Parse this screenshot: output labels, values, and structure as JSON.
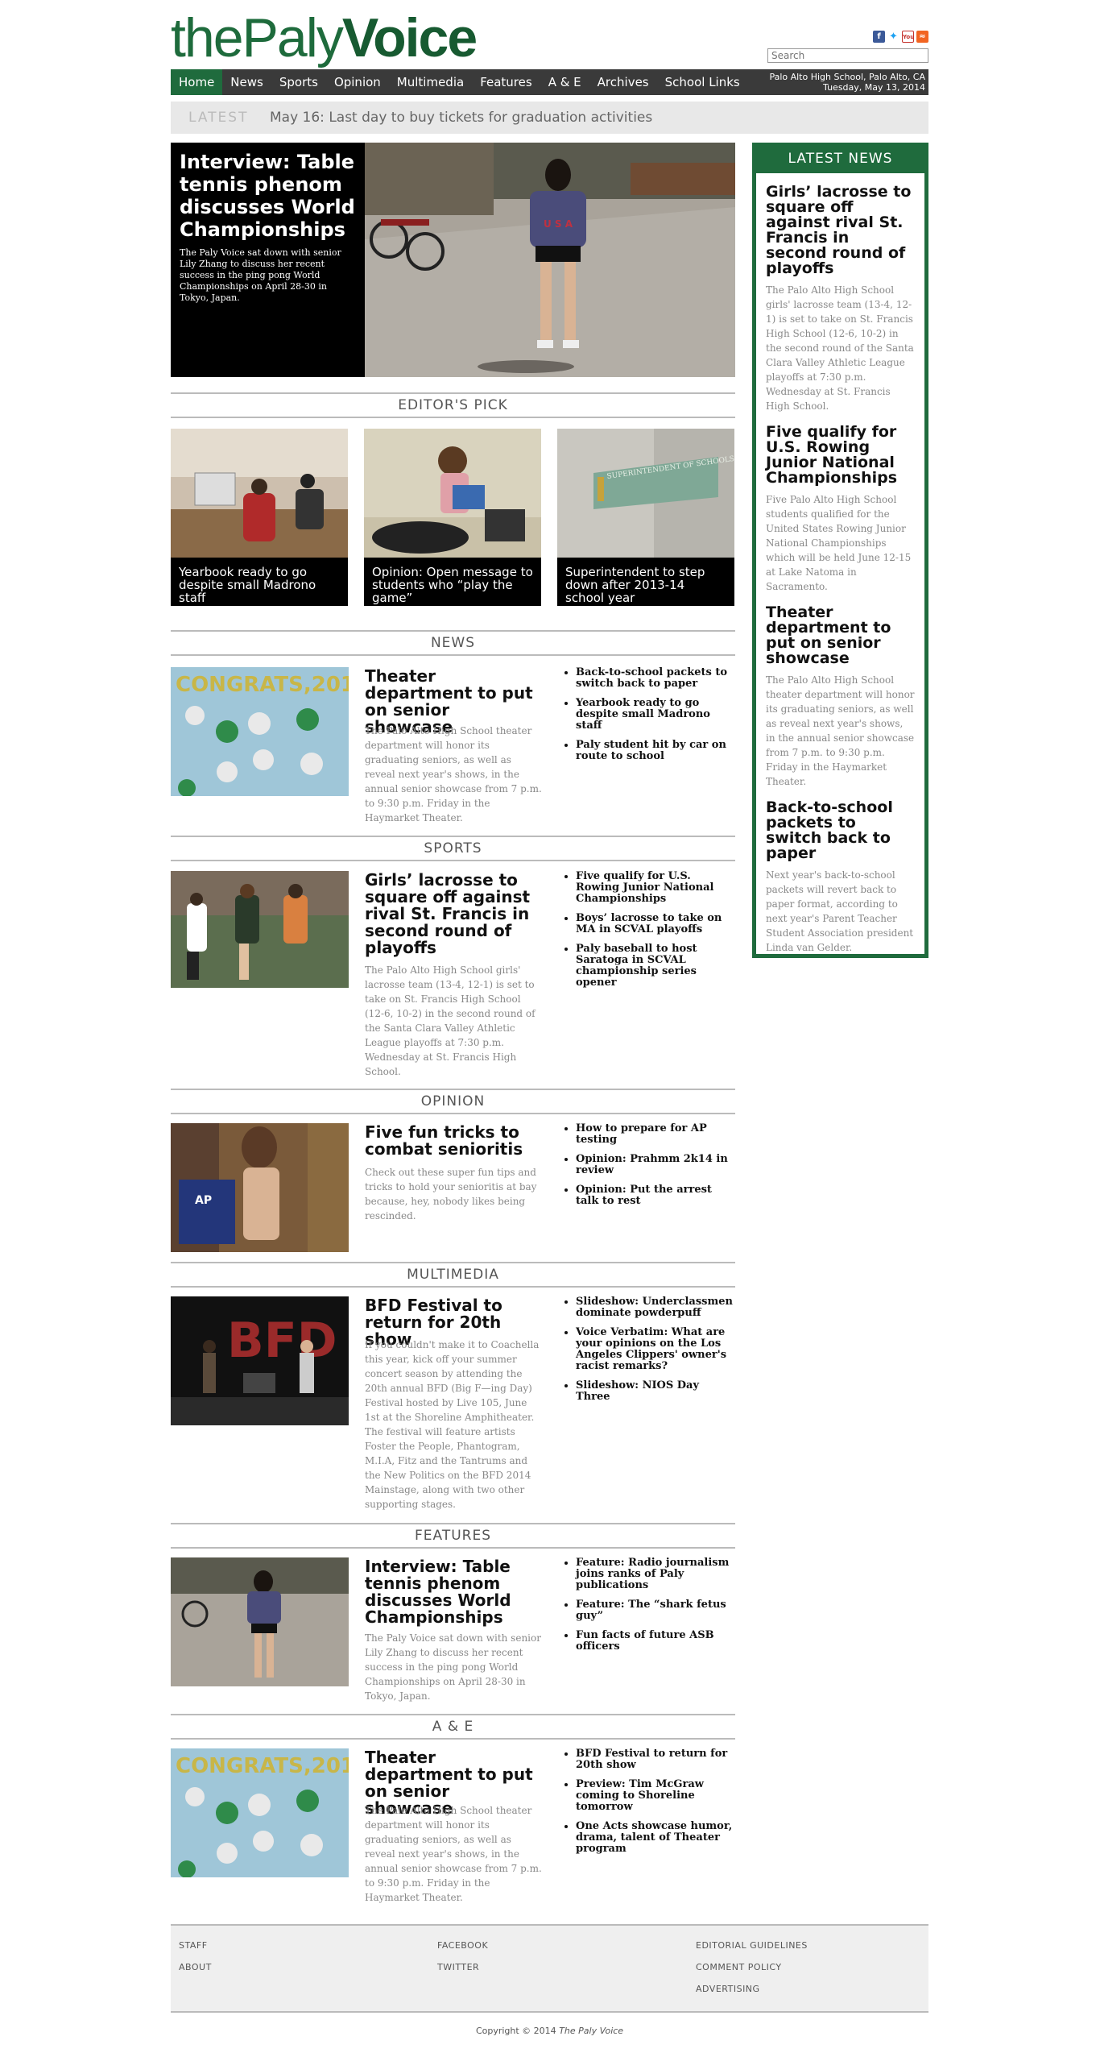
{
  "header": {
    "logo_the": "the",
    "logo_paly": "Paly",
    "logo_voice": "Voice",
    "search_placeholder": "Search",
    "social": [
      "facebook-icon",
      "twitter-icon",
      "youtube-icon",
      "rss-icon"
    ]
  },
  "nav": {
    "items": [
      "Home",
      "News",
      "Sports",
      "Opinion",
      "Multimedia",
      "Features",
      "A & E",
      "Archives",
      "School Links"
    ],
    "location": "Palo Alto High School, Palo Alto, CA",
    "date": "Tuesday, May 13, 2014"
  },
  "latest": {
    "tag": "LATEST",
    "text": "May 16: Last day to buy tickets for graduation activities"
  },
  "hero": {
    "title": "Interview: Table tennis phenom discusses World Championships",
    "desc": "The Paly Voice sat down with senior Lily Zhang to discuss her recent success in the ping pong World Championships on April 28-30 in Tokyo, Japan."
  },
  "editors_pick": {
    "heading": "EDITOR'S PICK",
    "items": [
      "Yearbook ready to go despite small Madrono staff",
      "Opinion: Open message to students who “play the game”",
      "Superintendent to step down after 2013-14 school year"
    ],
    "sign_text": "SUPERINTENDENT OF SCHOOLS"
  },
  "sections": [
    {
      "heading": "NEWS",
      "title": "Theater department to put on senior showcase",
      "desc": "The Palo Alto High School theater department will honor its graduating seniors, as well as reveal next year's shows, in the annual senior showcase from 7 p.m. to 9:30 p.m. Friday in the Haymarket Theater.",
      "links": [
        "Back-to-school packets to switch back to paper",
        "Yearbook ready to go despite small Madrono staff",
        "Paly student hit by car on route to school"
      ]
    },
    {
      "heading": "SPORTS",
      "title": "Girls’ lacrosse to square off against rival St. Francis in second round of playoffs",
      "desc": "The Palo Alto High School girls' lacrosse team (13-4, 12-1) is set to take on St. Francis High School (12-6, 10-2) in the second round of the Santa Clara Valley Athletic League playoffs at 7:30 p.m. Wednesday at St. Francis High School.",
      "links": [
        "Five qualify for U.S. Rowing Junior National Championships",
        "Boys’ lacrosse to take on MA in SCVAL playoffs",
        "Paly baseball to host Saratoga in SCVAL championship series opener"
      ]
    },
    {
      "heading": "OPINION",
      "title": "Five fun tricks to combat senioritis",
      "desc": "Check out these super fun tips and tricks to hold your senioritis at bay because, hey, nobody likes being rescinded.",
      "links": [
        "How to prepare for AP testing",
        "Opinion: Prahmm 2k14 in review",
        "Opinion: Put the arrest talk to rest"
      ]
    },
    {
      "heading": "MULTIMEDIA",
      "title": "BFD Festival to return for 20th show",
      "desc": "If you couldn't make it to Coachella this year, kick off your summer concert season by attending the 20th annual BFD (Big F—ing Day) Festival hosted by Live 105, June 1st at the Shoreline Amphitheater. The festival will feature artists Foster the People, Phantogram, M.I.A, Fitz and the Tantrums and the New Politics on the BFD 2014 Mainstage, along with two other supporting stages.",
      "links": [
        "Slideshow: Underclassmen dominate powderpuff",
        "Voice Verbatim: What are your opinions on the Los Angeles Clippers' owner's racist remarks?",
        "Slideshow: NIOS Day Three"
      ]
    },
    {
      "heading": "FEATURES",
      "title": "Interview: Table tennis phenom discusses World Championships",
      "desc": "The Paly Voice sat down with senior Lily Zhang to discuss her recent success in the ping pong World Championships on April 28-30 in Tokyo, Japan.",
      "links": [
        "Feature: Radio journalism joins ranks of Paly publications",
        "Feature: The “shark fetus guy”",
        "Fun facts of future ASB officers"
      ]
    },
    {
      "heading": "A & E",
      "title": "Theater department to put on senior showcase",
      "desc": "The Palo Alto High School theater department will honor its graduating seniors, as well as reveal next year's shows, in the annual senior showcase from 7 p.m. to 9:30 p.m. Friday in the Haymarket Theater.",
      "links": [
        "BFD Festival to return for 20th show",
        "Preview: Tim McGraw coming to Shoreline tomorrow",
        "One Acts showcase humor, drama, talent of Theater program"
      ]
    }
  ],
  "image_text": {
    "congrats": "CONGRATS,201",
    "bfd": "BFD",
    "ap_book": "AP"
  },
  "sidebar": {
    "heading": "LATEST NEWS",
    "stories": [
      {
        "title": "Girls’ lacrosse to square off against rival St. Francis in second round of playoffs",
        "desc": "The Palo Alto High School girls' lacrosse team (13-4, 12-1) is set to take on St. Francis High School (12-6, 10-2) in the second round of the Santa Clara Valley Athletic League playoffs at 7:30 p.m. Wednesday at St. Francis High School."
      },
      {
        "title": "Five qualify for U.S. Rowing Junior National Championships",
        "desc": "Five Palo Alto High School students qualified for the United States Rowing Junior National Championships which will be held June 12-15 at Lake Natoma in Sacramento."
      },
      {
        "title": "Theater department to put on senior showcase",
        "desc": "The Palo Alto High School theater department will honor its graduating seniors, as well as reveal next year's shows, in the annual senior showcase from 7 p.m. to 9:30 p.m. Friday in the Haymarket Theater."
      },
      {
        "title": "Back-to-school packets to switch back to paper",
        "desc": "Next year's back-to-school packets will revert back to paper format, according to next year's Parent Teacher Student Association president Linda van Gelder."
      }
    ]
  },
  "footer": {
    "col1": [
      "STAFF",
      "ABOUT"
    ],
    "col2": [
      "FACEBOOK",
      "TWITTER"
    ],
    "col3": [
      "EDITORIAL GUIDELINES",
      "COMMENT POLICY",
      "ADVERTISING"
    ],
    "copyright_prefix": "Copyright © 2014",
    "copyright_name": "The Paly Voice"
  }
}
